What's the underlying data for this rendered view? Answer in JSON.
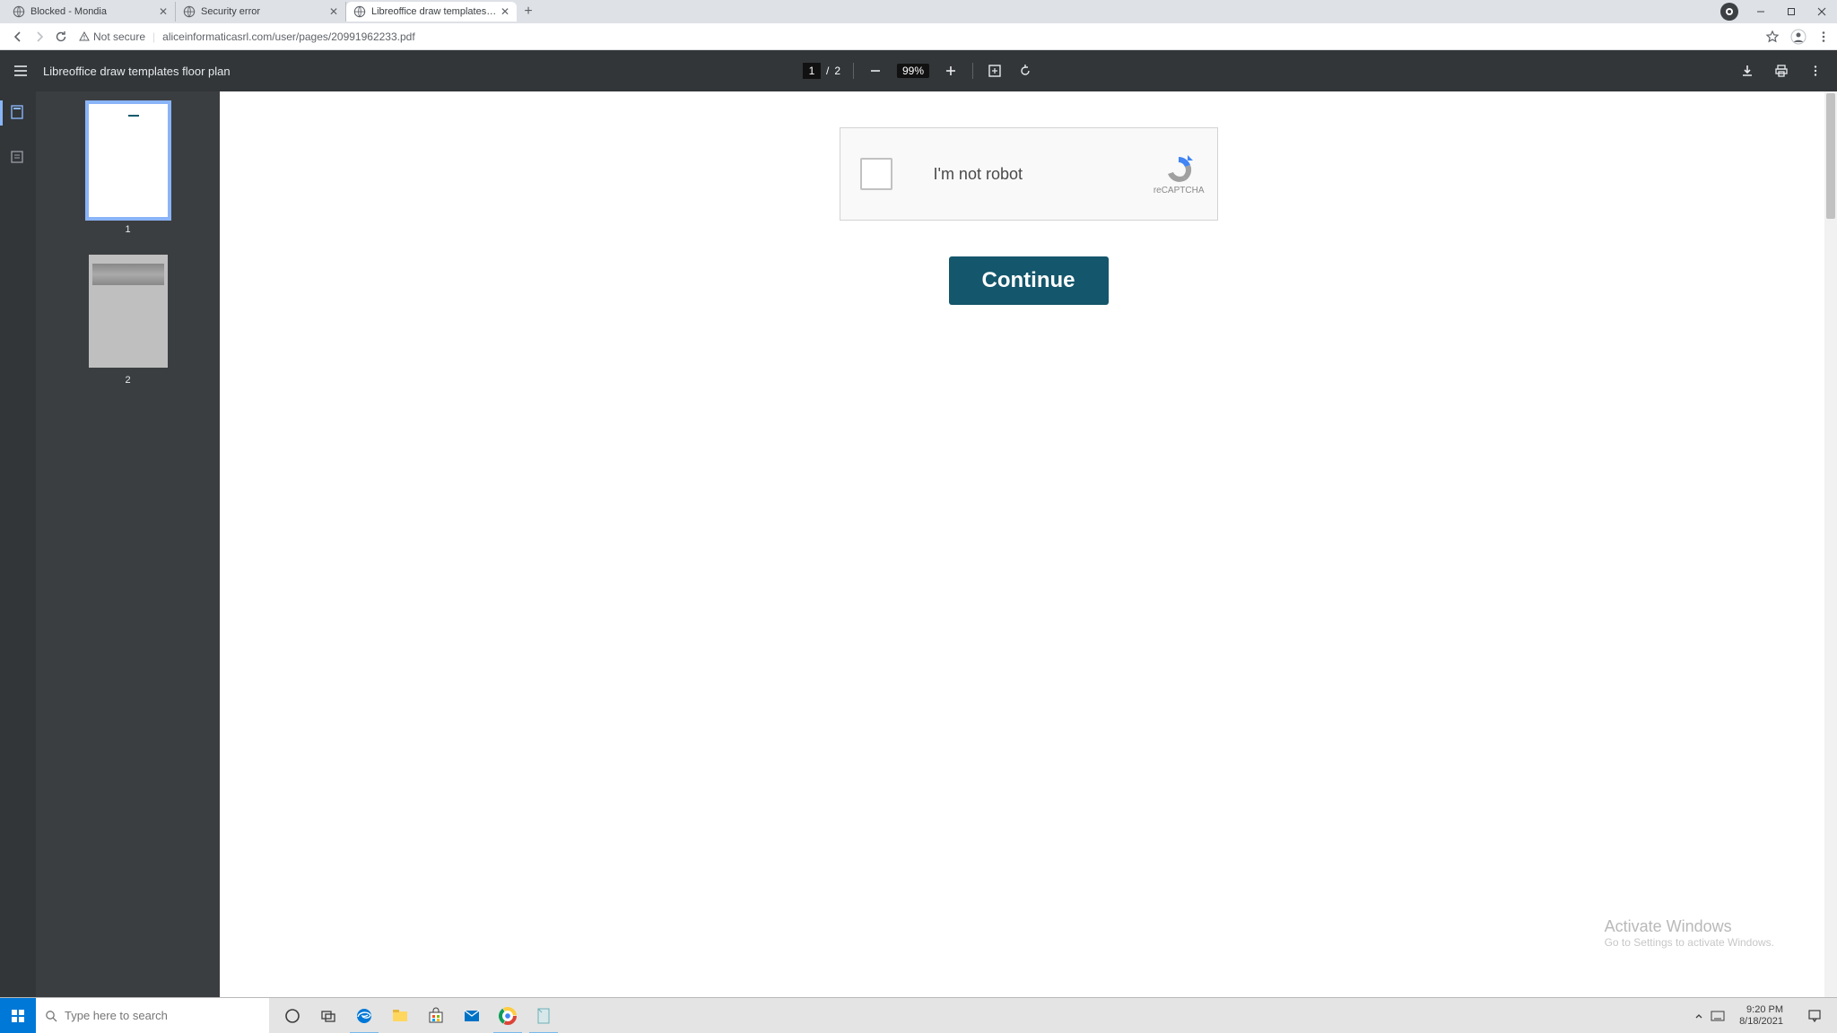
{
  "browser": {
    "tabs": [
      {
        "title": "Blocked - Mondia"
      },
      {
        "title": "Security error"
      },
      {
        "title": "Libreoffice draw templates floor"
      }
    ],
    "security_label": "Not secure",
    "url": "aliceinformaticasrl.com/user/pages/20991962233.pdf"
  },
  "pdf": {
    "title": "Libreoffice draw templates floor plan",
    "page_current": "1",
    "page_sep": "/",
    "page_total": "2",
    "zoom": "99%",
    "thumbs": [
      {
        "label": "1"
      },
      {
        "label": "2"
      }
    ]
  },
  "content": {
    "captcha_label": "I'm not robot",
    "captcha_brand": "reCAPTCHA",
    "continue": "Continue"
  },
  "watermark": {
    "line1": "Activate Windows",
    "line2": "Go to Settings to activate Windows."
  },
  "taskbar": {
    "search_placeholder": "Type here to search",
    "time": "9:20 PM",
    "date": "8/18/2021"
  }
}
